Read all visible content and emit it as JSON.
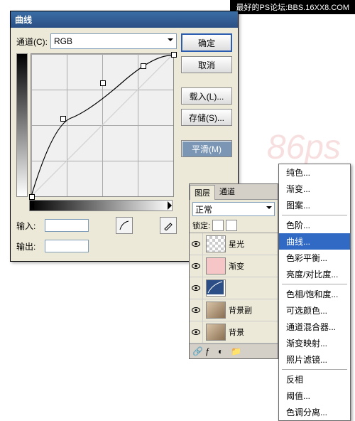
{
  "watermark_top": "最好的PS论坛:BBS.16XX8.COM",
  "dialog": {
    "title": "曲线",
    "channel_label": "通道(C):",
    "channel_value": "RGB",
    "input_label": "输入:",
    "output_label": "输出:",
    "buttons": {
      "ok": "确定",
      "cancel": "取消",
      "load": "载入(L)...",
      "save": "存储(S)...",
      "smooth": "平滑(M)"
    }
  },
  "panel": {
    "tabs": {
      "layers": "图层",
      "channels": "通道"
    },
    "mode": "正常",
    "lock_label": "锁定:",
    "layers": [
      {
        "name": "星光",
        "thumb": "checker"
      },
      {
        "name": "渐变",
        "thumb": "#f6c6c6"
      },
      {
        "name": "",
        "thumb": "curves"
      },
      {
        "name": "背景副",
        "thumb": "photo"
      },
      {
        "name": "背景",
        "thumb": "photo"
      }
    ]
  },
  "menu": {
    "items": [
      "纯色...",
      "渐变...",
      "图案...",
      "",
      "色阶...",
      "曲线...",
      "色彩平衡...",
      "亮度/对比度...",
      "",
      "色相/饱和度...",
      "可选颜色...",
      "通道混合器...",
      "渐变映射...",
      "照片滤镜...",
      "",
      "反相",
      "阈值...",
      "色调分离..."
    ],
    "selected": "曲线..."
  },
  "chart_data": {
    "type": "line",
    "title": "曲线",
    "xlabel": "输入",
    "ylabel": "输出",
    "xlim": [
      0,
      255
    ],
    "ylim": [
      0,
      255
    ],
    "series": [
      {
        "name": "RGB",
        "x": [
          0,
          56,
          128,
          200,
          255
        ],
        "y": [
          0,
          140,
          205,
          235,
          255
        ]
      }
    ]
  }
}
